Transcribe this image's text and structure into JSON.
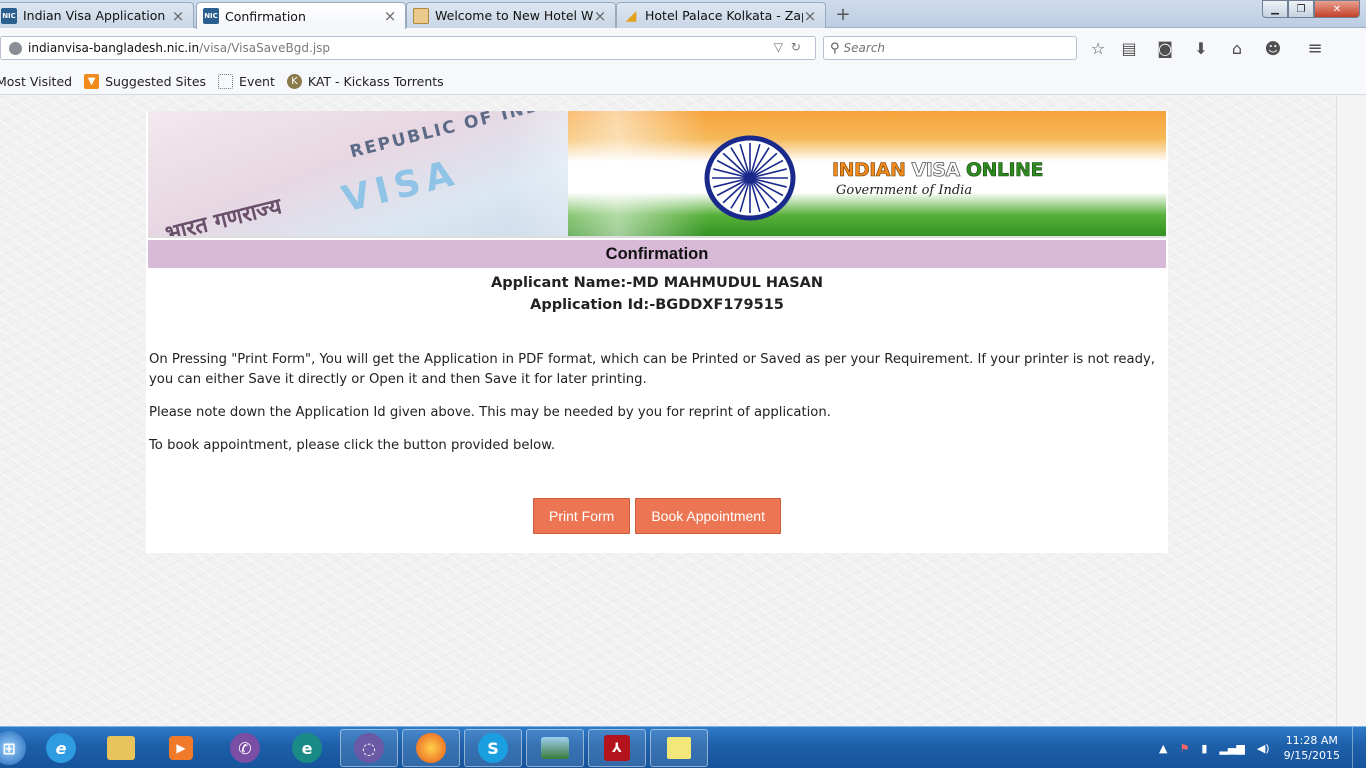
{
  "browser": {
    "tabs": [
      {
        "label": "Indian Visa Application",
        "icon": "nic-icon"
      },
      {
        "label": "Confirmation",
        "icon": "nic-icon",
        "active": true
      },
      {
        "label": "Welcome to New Hotel W...",
        "icon": "hotel-icon"
      },
      {
        "label": "Hotel Palace Kolkata - Zap...",
        "icon": "zap-icon"
      }
    ],
    "new_tab": "+",
    "url_host": "indianvisa-bangladesh.nic.in",
    "url_path": "/visa/VisaSaveBgd.jsp",
    "search_placeholder": "Search",
    "bookmarks": [
      "Most Visited",
      "Suggested Sites",
      "Event",
      "KAT - Kickass Torrents"
    ]
  },
  "banner": {
    "logo_part1": "INDIAN ",
    "logo_part2": "VISA ",
    "logo_part3": "ONLINE",
    "subtitle": "Government of India",
    "visa_text": "VISA",
    "republic_text": "REPUBLIC OF INDIA",
    "hindi_text": "भारत गणराज्य"
  },
  "page": {
    "heading": "Confirmation",
    "applicant_name": "Applicant Name:-MD MAHMUDUL HASAN",
    "application_id": "Application Id:-BGDDXF179515",
    "para1": "On Pressing \"Print Form\", You will get the Application in PDF format, which can be Printed or Saved as per your Requirement. If your printer is not ready, you can either Save it directly or Open it and then Save it for later printing.",
    "para2": "Please note down the Application Id given above. This may be needed by you for reprint of application.",
    "para3": "To book appointment, please click the button provided below.",
    "print_button": "Print Form",
    "book_button": "Book Appointment",
    "button_color": "#ec7654",
    "heading_bar_color": "#d8bad8"
  },
  "taskbar": {
    "apps": [
      "windows-start",
      "internet-explorer",
      "file-explorer",
      "media-player",
      "viber",
      "eset",
      "bittorrent",
      "firefox",
      "skype",
      "photo-viewer",
      "adobe-reader",
      "sticky-notes"
    ],
    "time": "11:28 AM",
    "date": "9/15/2015"
  }
}
